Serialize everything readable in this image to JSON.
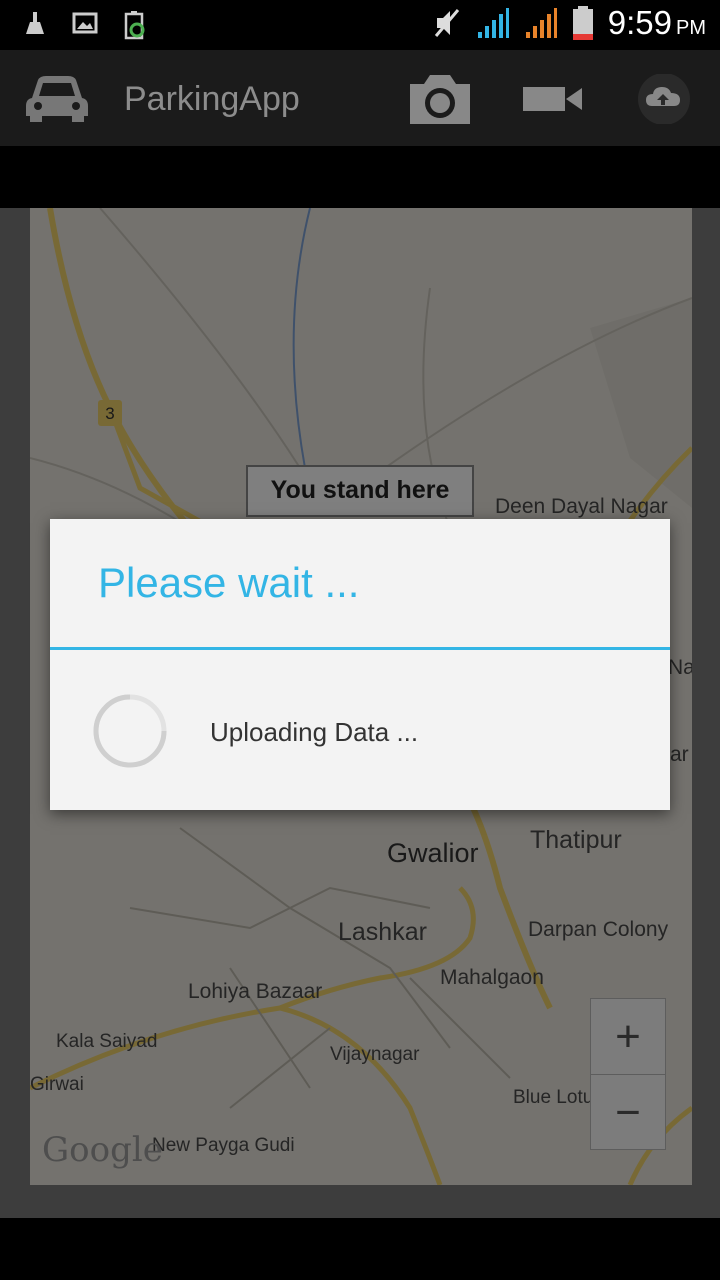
{
  "status_bar": {
    "time": "9:59",
    "ampm": "PM"
  },
  "action_bar": {
    "title": "ParkingApp",
    "icons": [
      "car-icon",
      "camera-icon",
      "video-camera-icon",
      "cloud-upload-icon"
    ]
  },
  "map": {
    "callout": "You stand here",
    "highway_number": "3",
    "labels": {
      "deen_dayal_nagar": "Deen Dayal Nagar",
      "na": "Na",
      "ar": "ar",
      "gwalior": "Gwalior",
      "thatipur": "Thatipur",
      "lashkar": "Lashkar",
      "darpan_colony": "Darpan Colony",
      "mahalgaon": "Mahalgaon",
      "lohiya_bazaar": "Lohiya Bazaar",
      "kala_saiyad": "Kala Saiyad",
      "vijaynagar": "Vijaynagar",
      "girwai": "Girwai",
      "blue_lotus_hills": "Blue Lotus Hills",
      "new_payga_gudi": "New Payga Gudi"
    },
    "zoom_in": "+",
    "zoom_out": "−",
    "attribution": "Google"
  },
  "dialog": {
    "title": "Please wait ...",
    "message": "Uploading Data ..."
  },
  "colors": {
    "accent": "#33b5e5",
    "action_bar": "#1b1b1b"
  }
}
